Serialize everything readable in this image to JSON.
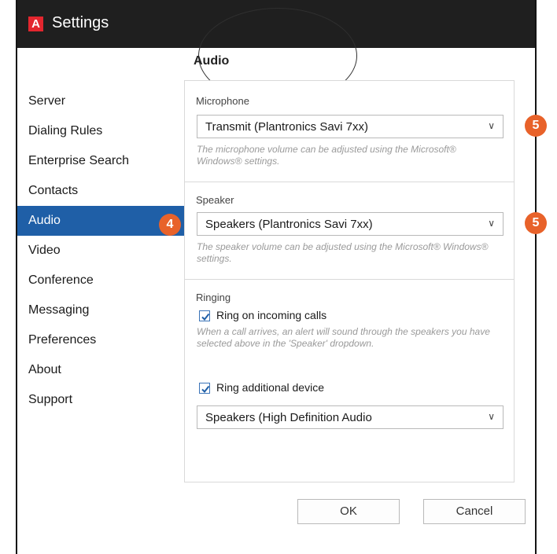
{
  "window": {
    "title": "Settings",
    "logo_letter": "A",
    "accent_color": "#e3262e"
  },
  "sidebar": {
    "items": [
      {
        "label": "Server",
        "active": false
      },
      {
        "label": "Dialing Rules",
        "active": false
      },
      {
        "label": "Enterprise Search",
        "active": false
      },
      {
        "label": "Contacts",
        "active": false
      },
      {
        "label": "Audio",
        "active": true
      },
      {
        "label": "Video",
        "active": false
      },
      {
        "label": "Conference",
        "active": false
      },
      {
        "label": "Messaging",
        "active": false
      },
      {
        "label": "Preferences",
        "active": false
      },
      {
        "label": "About",
        "active": false
      },
      {
        "label": "Support",
        "active": false
      }
    ],
    "active_color": "#1f5fa7"
  },
  "audio": {
    "title": "Audio",
    "microphone": {
      "label": "Microphone",
      "selected": "Transmit (Plantronics Savi 7xx)",
      "hint": "The microphone volume can be adjusted using the Microsoft® Windows® settings."
    },
    "speaker": {
      "label": "Speaker",
      "selected": "Speakers (Plantronics Savi 7xx)",
      "hint": "The speaker volume can be adjusted using the Microsoft® Windows® settings."
    },
    "ringing": {
      "label": "Ringing",
      "ring_incoming": {
        "label": "Ring on incoming calls",
        "checked": true
      },
      "hint": "When a call arrives, an alert will sound through the speakers you have selected above in the 'Speaker' dropdown.",
      "ring_additional": {
        "label": "Ring additional device",
        "checked": true
      },
      "device_selected": "Speakers (High Definition Audio"
    }
  },
  "buttons": {
    "ok": "OK",
    "cancel": "Cancel"
  },
  "callouts": {
    "four": "4",
    "five_a": "5",
    "five_b": "5",
    "color": "#e8622a"
  }
}
